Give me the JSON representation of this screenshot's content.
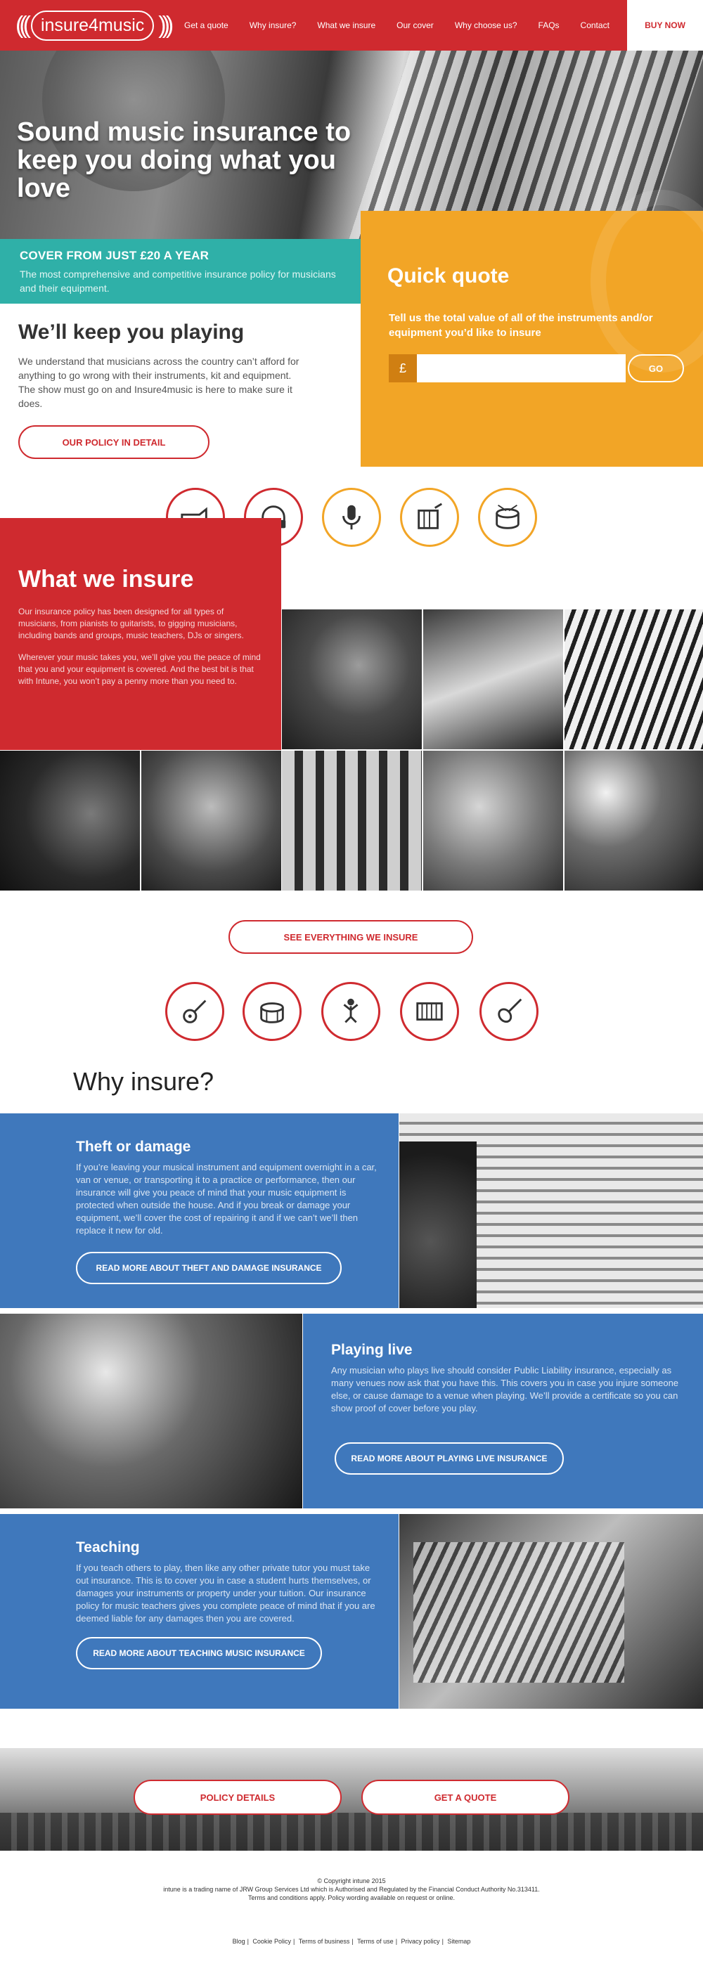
{
  "brand": {
    "name": "insure4music",
    "accent": "#cf2a2f",
    "orange": "#f2a526",
    "teal": "#2fb0a8",
    "blue": "#3f78bc"
  },
  "nav": {
    "items": [
      "Get a quote",
      "Why insure?",
      "What we insure",
      "Our cover",
      "Why choose us?",
      "FAQs",
      "Contact"
    ],
    "buy_now": "BUY NOW"
  },
  "hero": {
    "title": "Sound music insurance to keep you doing what you love"
  },
  "cover": {
    "title": "COVER FROM JUST £20 A YEAR",
    "subtitle": "The most comprehensive and competitive insurance policy for musicians and their equipment."
  },
  "keep_playing": {
    "title": "We’ll keep you playing",
    "body": "We understand that musicians across the country can’t afford for anything to go wrong with their instruments, kit and equipment.  The show must go on and Insure4music is here to make sure it does.",
    "button": "OUR POLICY IN DETAIL"
  },
  "quick_quote": {
    "title": "Quick quote",
    "prompt": "Tell us the total value of all of the instruments and/or equipment you’d like to insure",
    "currency": "£",
    "input_value": "",
    "button": "GO"
  },
  "top_icons": [
    "trumpet-icon",
    "headphones-icon",
    "microphone-icon",
    "drum-machine-icon",
    "drum-icon"
  ],
  "what_we_insure": {
    "title": "What we insure",
    "para1": "Our insurance policy has been designed for all types of musicians, from pianists to guitarists, to gigging musicians, including bands and groups, music teachers, DJs or singers.",
    "para2": "Wherever your music takes you, we’ll give you the peace of mind that you and your equipment is covered. And the best bit is that with Intune, you won’t pay a penny more than you need to.",
    "button": "SEE EVERYTHING WE INSURE"
  },
  "bottom_icons": [
    "acoustic-guitar-icon",
    "drum-icon",
    "singer-icon",
    "keyboard-icon",
    "violin-icon"
  ],
  "why_insure": {
    "title": "Why insure?",
    "sections": [
      {
        "title": "Theft or damage",
        "body": "If you’re leaving your musical instrument and equipment overnight in a car, van or venue, or transporting it to a practice or performance, then our insurance will give you peace of mind that your music equipment is protected when outside the house. And if you break or damage your equipment, we’ll cover the cost of repairing it and if we can’t we’ll then replace it new for old.",
        "button": "READ MORE ABOUT THEFT AND DAMAGE INSURANCE"
      },
      {
        "title": "Playing live",
        "body": "Any musician who plays live should consider Public Liability insurance, especially as many venues now ask that you have this. This covers you in case you injure someone else, or cause damage to a venue when playing. We’ll provide a certificate so you can show proof of cover before you play.",
        "button": "READ MORE ABOUT PLAYING LIVE INSURANCE"
      },
      {
        "title": "Teaching",
        "body": "If you teach others to play, then like any other private tutor you must take out insurance. This is to cover you in case a student hurts themselves, or damages your instruments or property under your tuition. Our insurance policy for music teachers gives you complete peace of mind that if you are deemed liable for any damages then you are covered.",
        "button": "READ MORE ABOUT TEACHING MUSIC INSURANCE"
      }
    ]
  },
  "cta": {
    "policy": "POLICY DETAILS",
    "quote": "GET A QUOTE"
  },
  "footer": {
    "copyright": "© Copyright intune 2015",
    "line2": "intune is a trading name of JRW Group Services Ltd which is Authorised and Regulated by the Financial Conduct Authority No.313411.",
    "line3": "Terms and conditions apply. Policy wording available on request or online.",
    "links": [
      "Blog",
      "Cookie Policy",
      "Terms of business",
      "Terms of use",
      "Privacy policy",
      "Sitemap"
    ]
  }
}
